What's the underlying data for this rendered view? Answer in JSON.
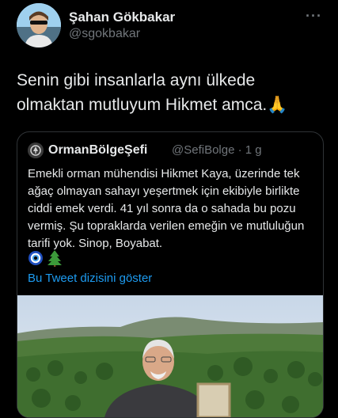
{
  "author": {
    "display_name": "Şahan Gökbakar",
    "handle": "@sgokbakar"
  },
  "more_icon": "more-icon",
  "tweet": {
    "text": "Senin gibi insanlarla aynı ülkede olmaktan mutluyum Hikmet amca.🙏"
  },
  "quoted_tweet": {
    "display_name": "OrmanBölgeŞefi",
    "handle_time": "@SefiBolge · 1 g",
    "text": "Emekli orman mühendisi Hikmet Kaya, üzerinde tek ağaç olmayan sahayı yeşertmek için ekibiyle birlikte ciddi emek verdi. 41 yıl sonra da o sahada bu pozu vermiş. Şu topraklarda verilen emeğin ve mutluluğun tarifi yok. Sinop, Boyabat.",
    "emojis": "🧿🌲",
    "show_thread": "Bu Tweet dizisini göster"
  },
  "colors": {
    "background": "#000000",
    "text": "#e7e9ea",
    "secondary": "#71767b",
    "link": "#1d9bf0",
    "border": "#2f3336"
  }
}
